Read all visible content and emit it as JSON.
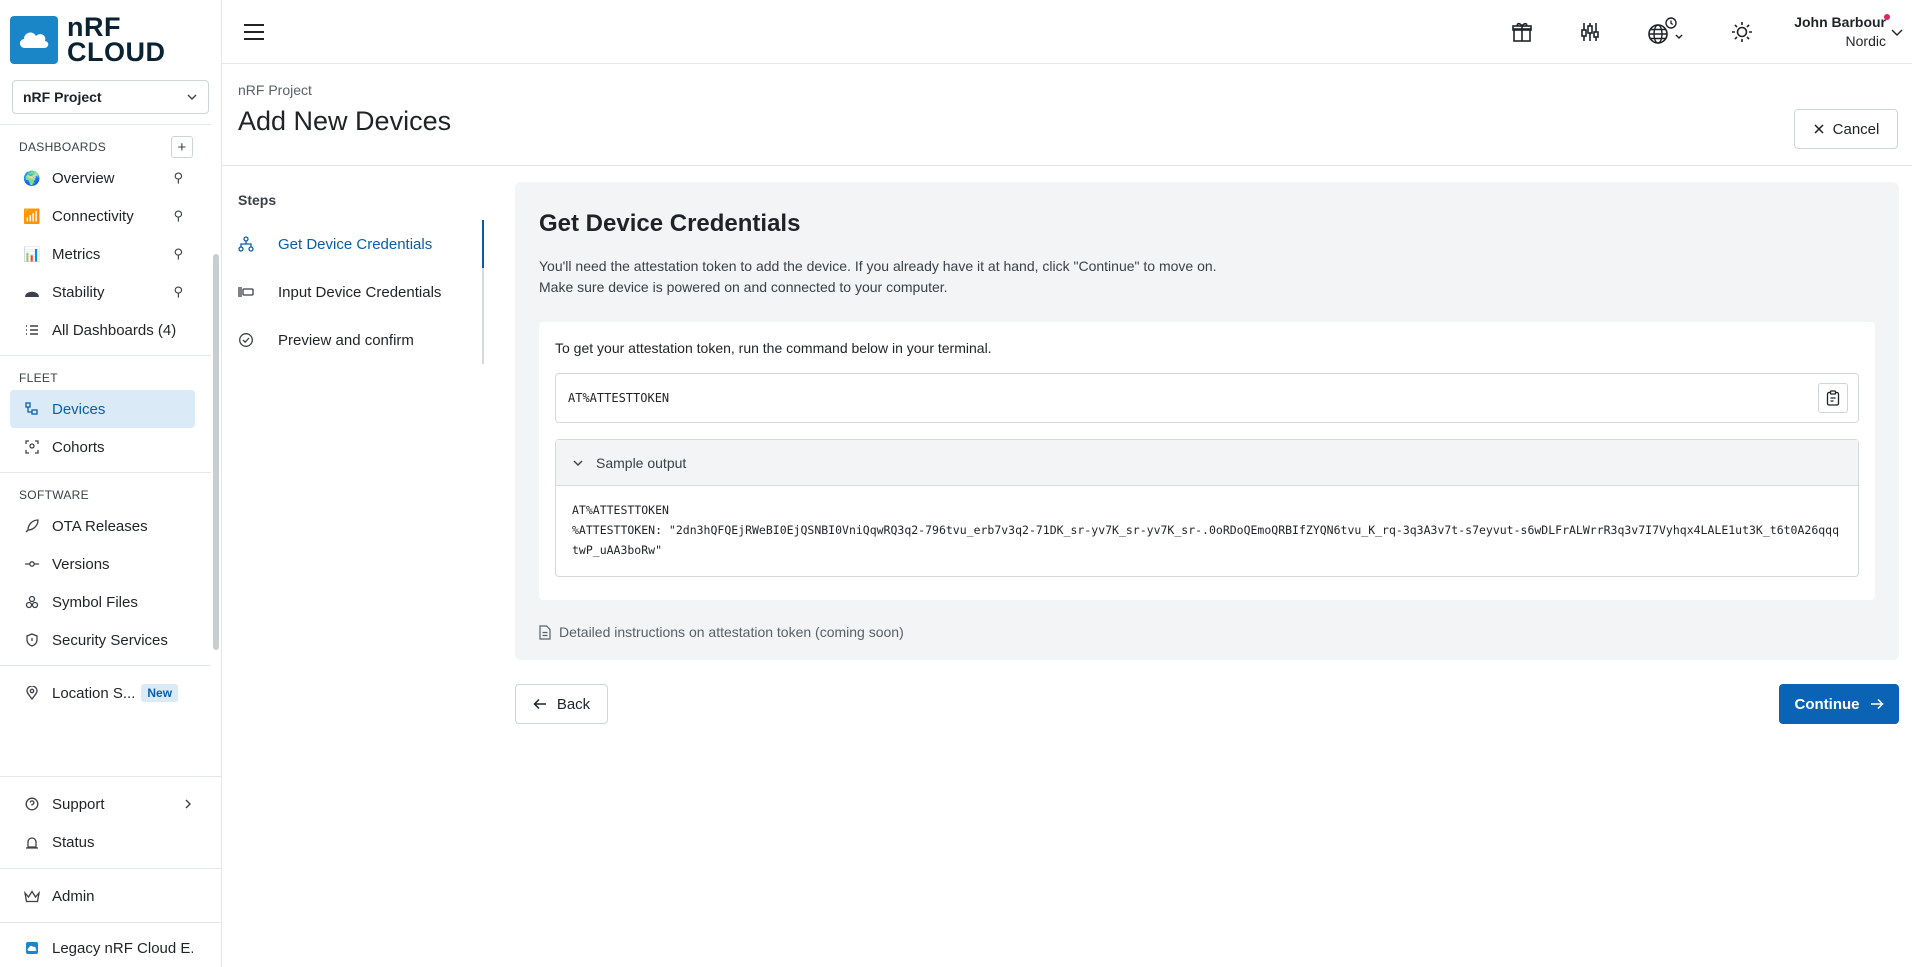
{
  "brand": {
    "line1": "nRF",
    "line2": "CLOUD",
    "color": "#1a86c8"
  },
  "project_select": {
    "value": "nRF Project"
  },
  "sidebar": {
    "dashboards_title": "DASHBOARDS",
    "dashboards": [
      {
        "label": "Overview",
        "icon": "globe-emoji-icon"
      },
      {
        "label": "Connectivity",
        "icon": "signal-chart-icon"
      },
      {
        "label": "Metrics",
        "icon": "bar-chart-icon"
      },
      {
        "label": "Stability",
        "icon": "stability-icon"
      },
      {
        "label": "All Dashboards (4)",
        "icon": "list-icon"
      }
    ],
    "fleet_title": "FLEET",
    "fleet": [
      {
        "label": "Devices",
        "icon": "devices-icon"
      },
      {
        "label": "Cohorts",
        "icon": "cohorts-icon"
      }
    ],
    "software_title": "SOFTWARE",
    "software": [
      {
        "label": "OTA Releases",
        "icon": "rocket-icon"
      },
      {
        "label": "Versions",
        "icon": "commit-icon"
      },
      {
        "label": "Symbol Files",
        "icon": "symbol-icon"
      },
      {
        "label": "Security Services",
        "icon": "shield-icon"
      }
    ],
    "location": {
      "label": "Location S...",
      "badge": "New"
    },
    "support": {
      "label": "Support"
    },
    "status": {
      "label": "Status"
    },
    "admin": {
      "label": "Admin"
    },
    "legacy": {
      "label": "Legacy nRF Cloud E..."
    }
  },
  "topbar": {
    "user_name": "John Barbour",
    "user_org": "Nordic"
  },
  "header": {
    "breadcrumb": "nRF Project",
    "title": "Add New Devices",
    "cancel_label": "Cancel"
  },
  "steps": {
    "title": "Steps",
    "items": [
      {
        "label": "Get Device Credentials",
        "active": true
      },
      {
        "label": "Input Device Credentials",
        "active": false
      },
      {
        "label": "Preview and confirm",
        "active": false
      }
    ]
  },
  "panel": {
    "title": "Get Device Credentials",
    "desc_line1": "You'll need the attestation token to add the device. If you already have it at hand, click \"Continue\" to move on.",
    "desc_line2": "Make sure device is powered on and connected to your computer.",
    "card_intro": "To get your attestation token, run the command below in your terminal.",
    "command": "AT%ATTESTTOKEN",
    "sample_label": "Sample output",
    "sample_line1": "AT%ATTESTTOKEN",
    "sample_line2": "%ATTESTTOKEN: \"2dn3hQFQEjRWeBI0EjQSNBI0VniQqwRQ3q2-796tvu_erb7v3q2-71DK_sr-yv7K_sr-yv7K_sr-.0oRDoQEmoQRBIfZYQN6tvu_K_rq-3q3A3v7t-s7eyvut-s6wDLFrALWrrR3q3v7I7Vyhqx4LALE1ut3K_t6t0A26qqqtwP_uAA3boRw\"",
    "instructions": "Detailed instructions on attestation token (coming soon)"
  },
  "actions": {
    "back_label": "Back",
    "continue_label": "Continue",
    "primary_color": "#0a63b5"
  }
}
